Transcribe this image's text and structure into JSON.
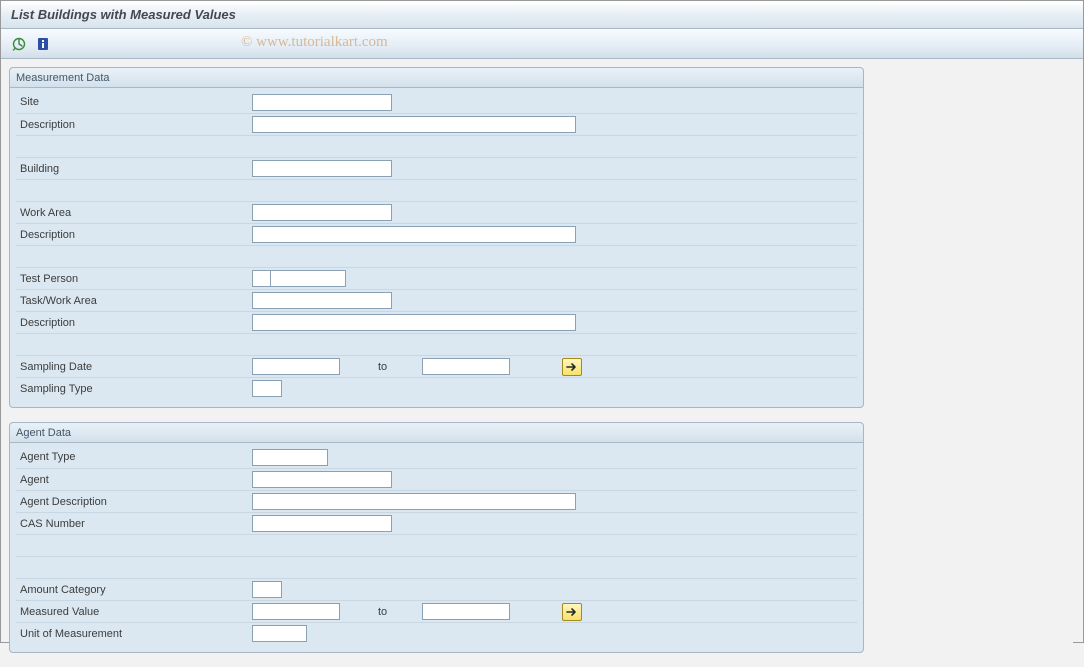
{
  "header": {
    "title": "List Buildings with Measured Values"
  },
  "watermark": "© www.tutorialkart.com",
  "groups": {
    "measurement": {
      "title": "Measurement Data",
      "site_label": "Site",
      "site_value": "",
      "desc1_label": "Description",
      "desc1_value": "",
      "building_label": "Building",
      "building_value": "",
      "workarea_label": "Work Area",
      "workarea_value": "",
      "desc2_label": "Description",
      "desc2_value": "",
      "testperson_label": "Test Person",
      "testperson_value_a": "",
      "testperson_value_b": "",
      "taskwa_label": "Task/Work Area",
      "taskwa_value": "",
      "desc3_label": "Description",
      "desc3_value": "",
      "sampdate_label": "Sampling Date",
      "sampdate_from": "",
      "sampdate_to_label": "to",
      "sampdate_to": "",
      "samptype_label": "Sampling Type",
      "samptype_value": ""
    },
    "agent": {
      "title": "Agent Data",
      "agenttype_label": "Agent Type",
      "agenttype_value": "",
      "agent_label": "Agent",
      "agent_value": "",
      "agentdesc_label": "Agent Description",
      "agentdesc_value": "",
      "cas_label": "CAS Number",
      "cas_value": "",
      "amountcat_label": "Amount Category",
      "amountcat_value": "",
      "measval_label": "Measured Value",
      "measval_from": "",
      "measval_to_label": "to",
      "measval_to": "",
      "uom_label": "Unit of Measurement",
      "uom_value": ""
    }
  }
}
